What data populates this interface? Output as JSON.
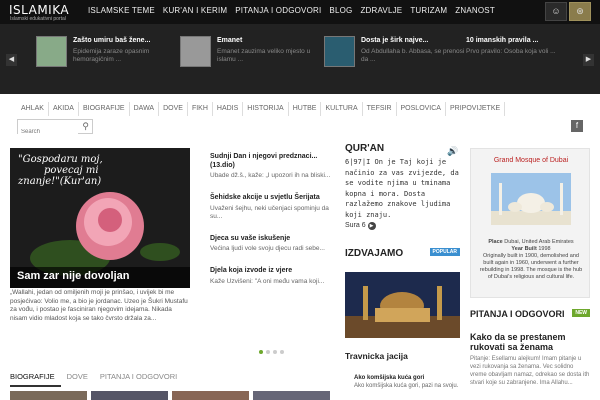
{
  "site": {
    "title": "ISLAMIKA",
    "tagline": "Islamski edukativni portal"
  },
  "nav": [
    "ISLAMSKE TEME",
    "KUR'AN I KERIM",
    "PITANJA I ODGOVORI",
    "BLOG",
    "ZDRAVLJE",
    "TURIZAM",
    "ZNANOST"
  ],
  "top_buttons": {
    "user_icon": "user-icon",
    "rss_icon": "rss-icon"
  },
  "slider": [
    {
      "title": "Zašto umiru baš žene...",
      "desc": "Epidemija zaraze opasnim hemoragičnim ..."
    },
    {
      "title": "Emanet",
      "desc": "Emanet zauzima veliko mjesto u islamu ..."
    },
    {
      "title": "Dosta je širk najve...",
      "desc": "Od Abdullaha b. Abbasa, se prenosi da ..."
    },
    {
      "title": "10 imanskih pravila ...",
      "desc": "Prvo pravilo: Osoba koja voli ..."
    }
  ],
  "categories": [
    "AHLAK",
    "AKIDA",
    "BIOGRAFIJE",
    "DAWA",
    "DOVE",
    "FIKH",
    "HADIS",
    "HISTORIJA",
    "HUTBE",
    "KULTURA",
    "TEFSIR",
    "POSLOVICA",
    "PRIPOVIJETKE"
  ],
  "search": {
    "placeholder": "Search"
  },
  "feature": {
    "quote_line1": "\"Gospodaru moj,",
    "quote_line2": "povecaj mi",
    "quote_line3": "znanje!\"(Kur'an)",
    "title": "Sam zar nije dovoljan",
    "excerpt": "„Wallahi, jedan od omiljenih moji je prinšao, i uvijek bi me posjećivao: Volio me, a bio je jordanac. Uzeo je Šukri Mustafu za vođu, i postao je fasciniran njegovim idejama. Nikada nisam vidio mladost koja se tako čvrsto držala za..."
  },
  "posts": [
    {
      "title": "Sudnji Dan i njegovi predznaci... (13.dio)",
      "desc": "Ubade dž.š., kaže: „I upozori ih na bliski..."
    },
    {
      "title": "Šehidske akcije u svjetlu Šerijata",
      "desc": "Uvaženi šejhu, neki učenjaci spominju da su..."
    },
    {
      "title": "Djeca su vaše iskušenje",
      "desc": "Većina ljudi vole svoju djecu radi sebe..."
    },
    {
      "title": "Djela koja izvode iz vjere",
      "desc": "Kaže Uzvišeni: \"A oni među vama koji..."
    }
  ],
  "quran": {
    "title": "QUR'AN",
    "verse": "6|97|I On je Taj koji je načinio za vas zvijezde, da se vodite njima u tminama kopna i mora. Dosta razlažemo znakove ljudima koji znaju.",
    "ref": "Sura 6"
  },
  "izdvajamo": {
    "title": "IZDVAJAMO",
    "badge": "POPULAR",
    "caption": "Travnicka jacija",
    "sub_title": "Ako komšijska kuća gori",
    "sub_desc": "Ako komšijska kuća gori, pazi na svoju."
  },
  "ad": {
    "title": "Grand Mosque of Dubai",
    "place_label": "Place",
    "place": "Dubai, United Arab Emirates",
    "year_label": "Year Built",
    "year": "1998",
    "text": "Originally built in 1900, demolished and built again in 1960, underwent a further rebuilding in 1998. The mosque is the hub of Dubai's religious and cultural life."
  },
  "pitanja": {
    "title": "PITANJA I ODGOVORI",
    "badge": "NEW",
    "post_title": "Kako da se prestanem rukovati sa ženama",
    "post_text": "Pitanje: Esellamu alejkum! Imam pitanje u vezi rukovanja sa ženama. Vec solidno vreme obavljam namaz, odrekao se dosta ith stvari koje su zabranjene. Ima Allahu..."
  },
  "bottom_tabs": [
    "BIOGRAFIJE",
    "DOVE",
    "PITANJA I ODGOVORI"
  ]
}
